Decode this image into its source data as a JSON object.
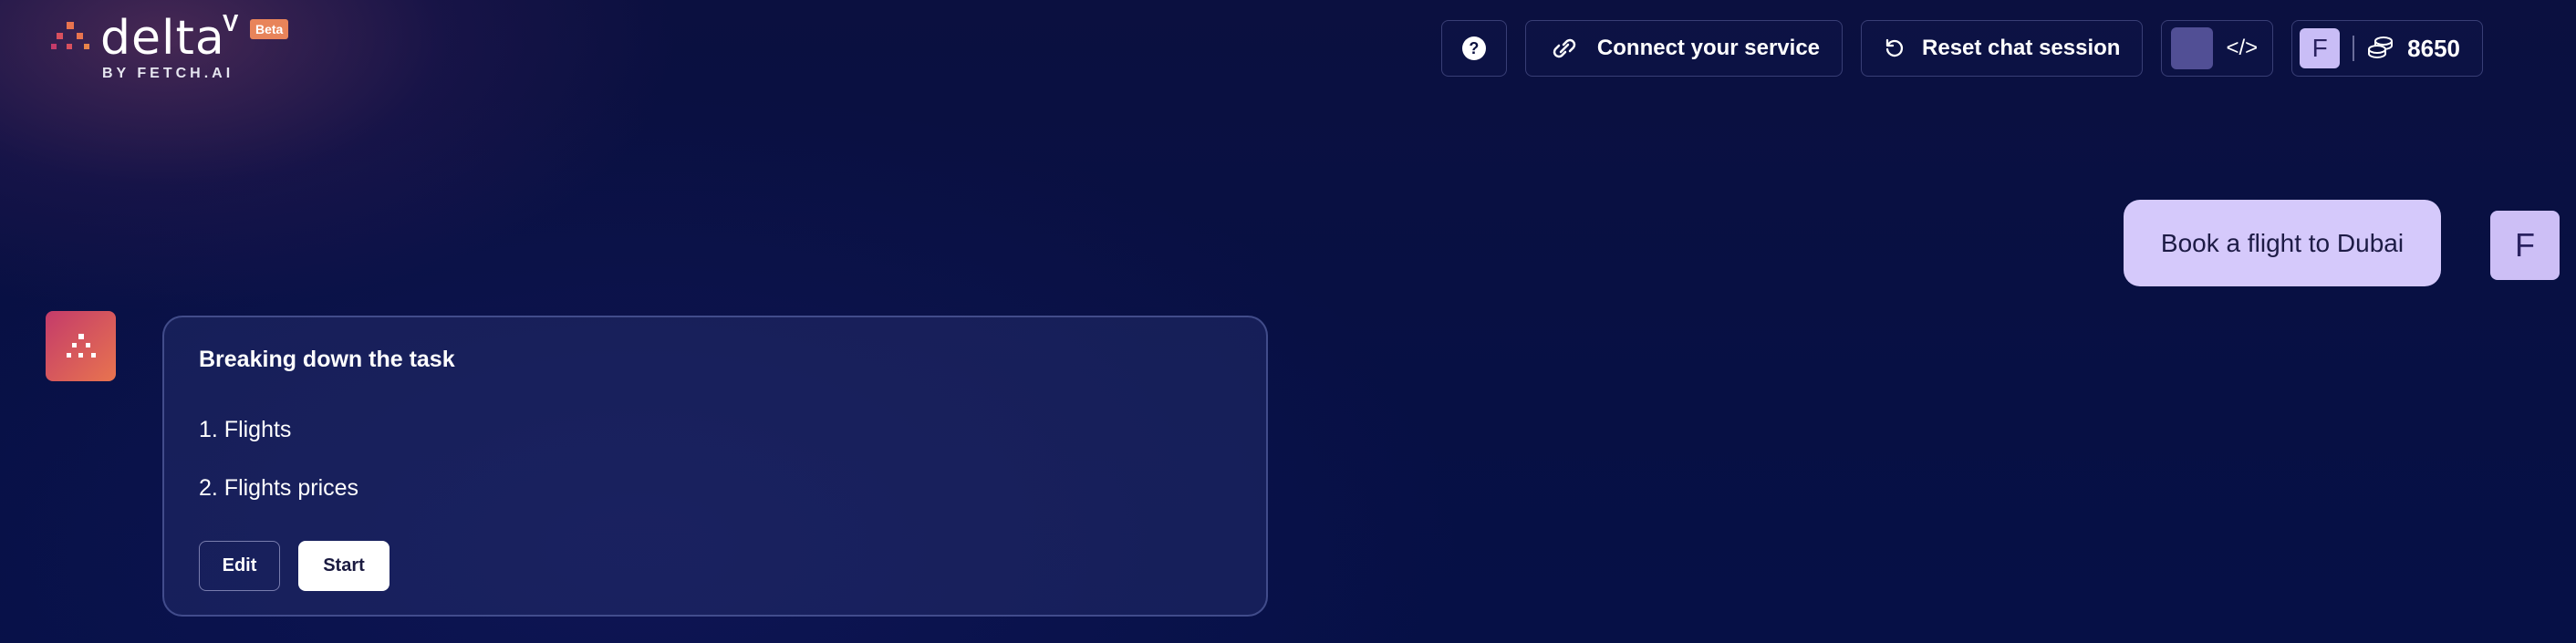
{
  "brand": {
    "name": "delta",
    "superscript": "V",
    "badge": "Beta",
    "byline": "BY FETCH.AI",
    "icon": "fetch-dots-logo"
  },
  "topbar": {
    "help_icon": "question-circle-icon",
    "help_glyph": "?",
    "connect_label": "Connect your service",
    "connect_icon": "link-icon",
    "reset_label": "Reset chat session",
    "reset_icon": "undo-icon",
    "code_icon": "code-brackets-icon",
    "code_glyph": "</>",
    "user_initial": "F",
    "coins_icon": "coins-stack-icon",
    "credits": "8650"
  },
  "chat": {
    "user_message": "Book a flight to Dubai",
    "user_initial": "F",
    "agent_card": {
      "title": "Breaking down the task",
      "items": [
        "1. Flights",
        "2. Flights prices"
      ],
      "edit_label": "Edit",
      "start_label": "Start"
    }
  },
  "colors": {
    "background": "#071044",
    "user_bubble": "#d5c9fb",
    "beta_badge": "#e8845a",
    "agent_gradient_start": "#c43b6a",
    "agent_gradient_end": "#e8744f"
  }
}
